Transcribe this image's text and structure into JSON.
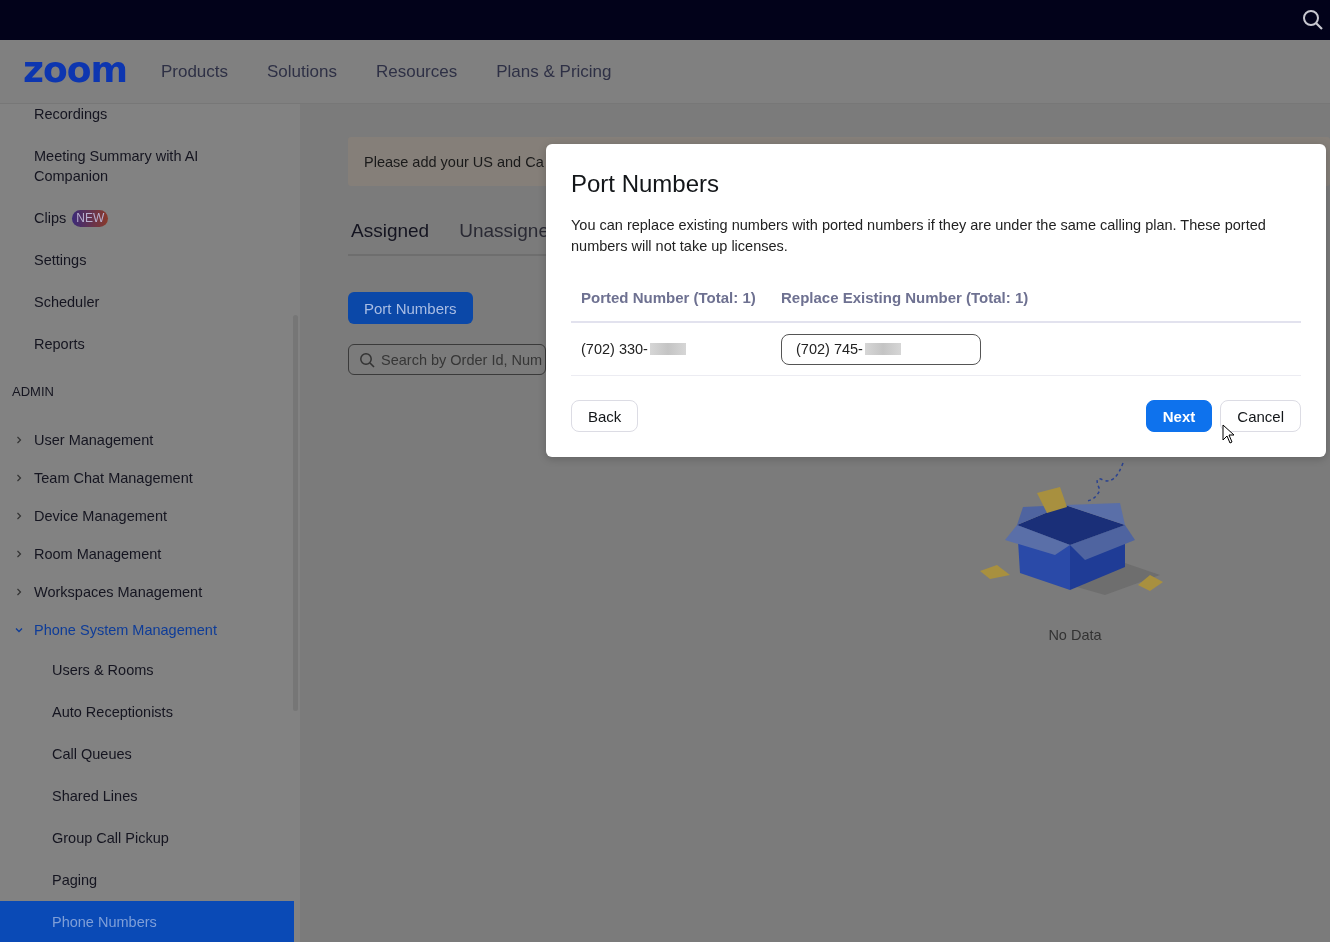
{
  "header": {
    "logo": "zoom",
    "nav": [
      "Products",
      "Solutions",
      "Resources",
      "Plans & Pricing"
    ]
  },
  "sidebar": {
    "items": [
      {
        "kind": "link",
        "label": "Recordings",
        "selected": false
      },
      {
        "kind": "link",
        "label": "Meeting Summary with AI Companion",
        "selected": false
      },
      {
        "kind": "link",
        "label": "Clips",
        "badge": "NEW",
        "selected": false
      },
      {
        "kind": "link",
        "label": "Settings",
        "selected": false
      },
      {
        "kind": "link",
        "label": "Scheduler",
        "selected": false
      },
      {
        "kind": "link",
        "label": "Reports",
        "selected": false
      },
      {
        "kind": "section",
        "label": "ADMIN"
      },
      {
        "kind": "group",
        "label": "User Management",
        "expanded": false
      },
      {
        "kind": "group",
        "label": "Team Chat Management",
        "expanded": false
      },
      {
        "kind": "group",
        "label": "Device Management",
        "expanded": false
      },
      {
        "kind": "group",
        "label": "Room Management",
        "expanded": false
      },
      {
        "kind": "group",
        "label": "Workspaces Management",
        "expanded": false
      },
      {
        "kind": "group",
        "label": "Phone System Management",
        "expanded": true,
        "children": [
          {
            "label": "Users & Rooms",
            "selected": false
          },
          {
            "label": "Auto Receptionists",
            "selected": false
          },
          {
            "label": "Call Queues",
            "selected": false
          },
          {
            "label": "Shared Lines",
            "selected": false
          },
          {
            "label": "Group Call Pickup",
            "selected": false
          },
          {
            "label": "Paging",
            "selected": false
          },
          {
            "label": "Phone Numbers",
            "selected": true
          }
        ]
      }
    ]
  },
  "main": {
    "banner": "Please add your US and Ca",
    "tabs": [
      {
        "label": "Assigned",
        "selected": true
      },
      {
        "label": "Unassigne",
        "selected": false
      }
    ],
    "port_button": "Port Numbers",
    "search": {
      "placeholder": "Search by Order Id, Num"
    },
    "empty_state": "No Data"
  },
  "dialog": {
    "title": "Port Numbers",
    "description": "You can replace existing numbers with ported numbers if they are under the same calling plan. These ported numbers will not take up licenses.",
    "columns": [
      "Ported Number (Total: 1)",
      "Replace Existing Number (Total: 1)"
    ],
    "rows": [
      {
        "ported_number": "(702) 330-",
        "replacement": "(702) 745-"
      }
    ],
    "buttons": [
      {
        "label": "Back",
        "kind": "default"
      },
      {
        "label": "Next",
        "kind": "primary"
      },
      {
        "label": "Cancel",
        "kind": "default"
      }
    ]
  }
}
